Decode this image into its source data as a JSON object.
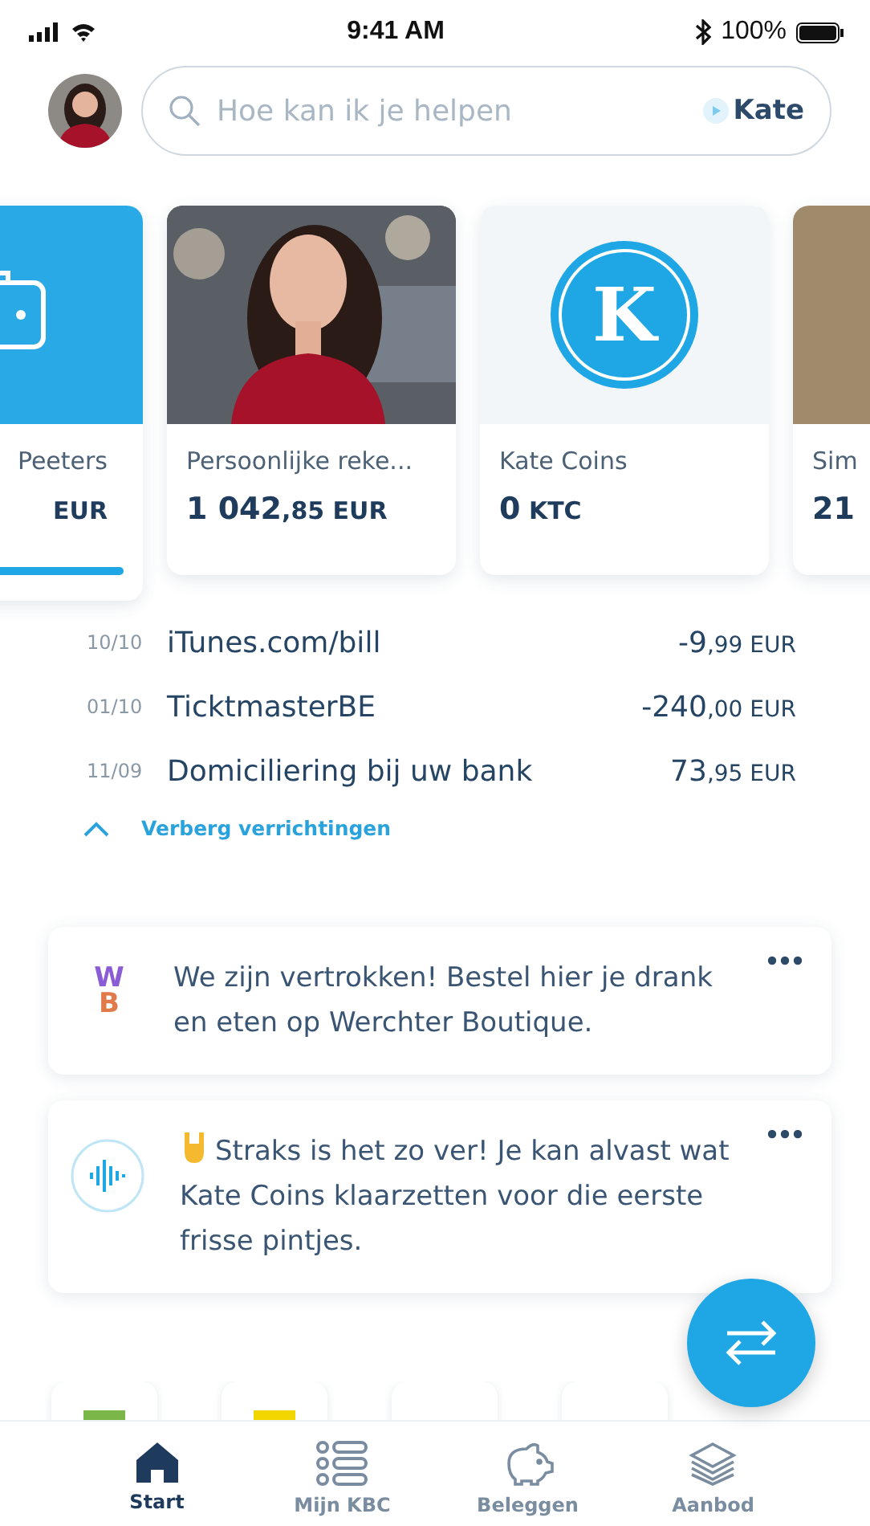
{
  "status_bar": {
    "time": "9:41 AM",
    "battery": "100%"
  },
  "search": {
    "placeholder": "Hoe kan ik je helpen",
    "assistant": "Kate"
  },
  "accounts": [
    {
      "kind": "wallet",
      "name": "Peeters",
      "currency": "EUR",
      "selected": true
    },
    {
      "kind": "picture",
      "name": "Persoonlijke reke...",
      "amount": "1 042",
      "cents": ",85",
      "currency": "EUR",
      "selected": false
    },
    {
      "kind": "coin",
      "coin_letter": "K",
      "name": "Kate Coins",
      "amount": "0",
      "currency": "KTC",
      "selected": false
    },
    {
      "kind": "plain",
      "name": "Sim",
      "amount": "21",
      "selected": false
    }
  ],
  "transactions": [
    {
      "date": "10/10",
      "name": "iTunes.com/bill",
      "amount": "-9",
      "cents": ",99",
      "currency": "EUR"
    },
    {
      "date": "01/10",
      "name": "TicktmasterBE",
      "amount": "-240",
      "cents": ",00",
      "currency": "EUR"
    },
    {
      "date": "11/09",
      "name": "Domiciliering bij uw bank",
      "amount": "73",
      "cents": ",95",
      "currency": "EUR"
    }
  ],
  "toggle": {
    "label": "Verberg verrichtingen",
    "expanded": true
  },
  "messages": [
    {
      "kind": "logo",
      "logo_top": "W",
      "logo_bottom": "B",
      "text": "We zijn vertrokken! Bestel hier je drank en eten op Werchter Boutique."
    },
    {
      "kind": "voice",
      "text": "Straks is het zo ver! Je kan alvast wat Kate Coins klaarzetten voor die eerste frisse pintjes."
    }
  ],
  "tiles": [
    {
      "kind": "mark",
      "color": "#7ab648"
    },
    {
      "kind": "mark",
      "color": "#f2d600"
    },
    {
      "kind": "blank"
    },
    {
      "kind": "blank"
    }
  ],
  "nav": [
    {
      "kind": "home",
      "label": "Start",
      "selected": true
    },
    {
      "kind": "list",
      "label": "Mijn KBC",
      "selected": false
    },
    {
      "kind": "piggy",
      "label": "Beleggen",
      "selected": false
    },
    {
      "kind": "layers",
      "label": "Aanbod",
      "selected": false
    }
  ]
}
